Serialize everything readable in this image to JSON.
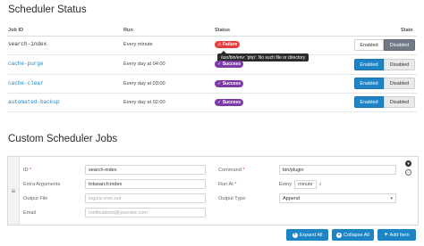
{
  "status_section": {
    "title": "Scheduler Status",
    "columns": {
      "job_id": "Job ID",
      "run": "Run",
      "status": "Status",
      "state": "State"
    },
    "rows": [
      {
        "job_id": "search-index",
        "run": "Every minute",
        "status": "Failure",
        "status_type": "failure",
        "enabled": "Enabled",
        "disabled": "Disabled",
        "active": "disabled"
      },
      {
        "job_id": "cache-purge",
        "run": "Every day at 04:00",
        "status": "Success",
        "status_type": "success",
        "enabled": "Enabled",
        "disabled": "Disabled",
        "active": "enabled"
      },
      {
        "job_id": "cache-clear",
        "run": "Every day at 03:00",
        "status": "Success",
        "status_type": "success",
        "enabled": "Enabled",
        "disabled": "Disabled",
        "active": "enabled"
      },
      {
        "job_id": "automated-backup",
        "run": "Every day at 02:00",
        "status": "Success",
        "status_type": "success",
        "enabled": "Enabled",
        "disabled": "Disabled",
        "active": "enabled"
      }
    ],
    "tooltip": "/usr/bin/env: 'php': No such file or directory"
  },
  "custom_section": {
    "title": "Custom Scheduler Jobs",
    "fields": {
      "id_label": "ID",
      "id_value": "search-index",
      "extra_args_label": "Extra Arguments",
      "extra_args_value": "tntsearch:index",
      "output_file_label": "Output File",
      "output_file_placeholder": "logs/a-cron.out",
      "email_label": "Email",
      "email_placeholder": "notifications@yoursite.com",
      "command_label": "Command",
      "command_value": "bin/plugin",
      "run_at_label": "Run At",
      "run_at_every": "Every",
      "run_at_unit": "minute",
      "run_at_clear": "x",
      "output_type_label": "Output Type",
      "output_type_value": "Append"
    },
    "buttons": {
      "expand_all": "Expand All",
      "collapse_all": "Collapse All",
      "add_item": "Add Item"
    }
  },
  "colors": {
    "primary": "#1d84c6",
    "failure": "#e53d3d",
    "success": "#7c3aa8",
    "disabled_active": "#6f7a86"
  }
}
